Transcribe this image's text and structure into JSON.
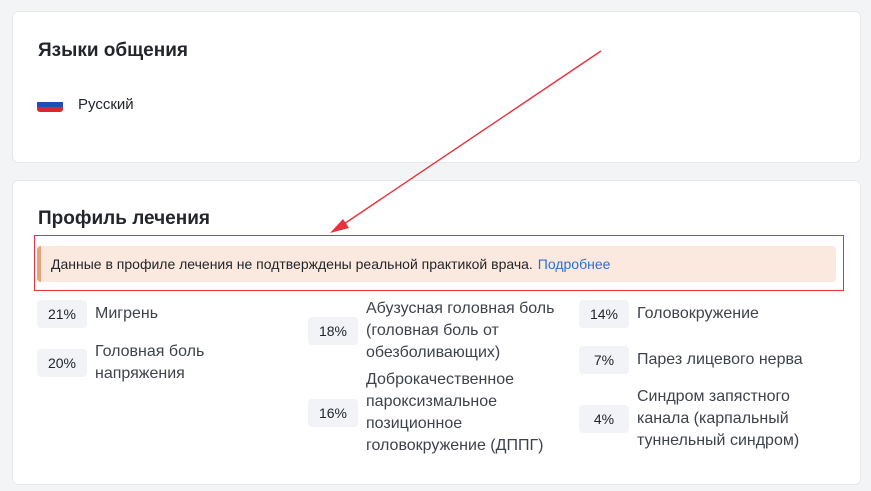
{
  "languages_card": {
    "title": "Языки общения",
    "items": [
      {
        "flag_icon": "russia-flag-icon",
        "label": "Русский"
      }
    ]
  },
  "profile_card": {
    "title": "Профиль лечения",
    "warning": {
      "text": "Данные в профиле лечения не подтверждены реальной практикой врача.",
      "link_label": "Подробнее",
      "accent_color": "#e8a27c",
      "background_color": "#fbe9df"
    },
    "conditions": [
      {
        "percent": "21%",
        "label": "Мигрень"
      },
      {
        "percent": "20%",
        "label": "Головная боль напряжения"
      },
      {
        "percent": "18%",
        "label": "Абузусная головная боль (головная боль от обезболивающих)"
      },
      {
        "percent": "16%",
        "label": "Доброкачественное пароксизмальное позиционное головокружение (ДППГ)"
      },
      {
        "percent": "14%",
        "label": "Головокружение"
      },
      {
        "percent": "7%",
        "label": "Парез лицевого нерва"
      },
      {
        "percent": "4%",
        "label": "Синдром запястного канала (карпальный туннельный синдром)"
      }
    ]
  },
  "annotation": {
    "color": "#e8323c"
  },
  "colors": {
    "link": "#2c6fd4",
    "badge_background": "#f1f3f7",
    "page_background": "#f3f4f6"
  }
}
